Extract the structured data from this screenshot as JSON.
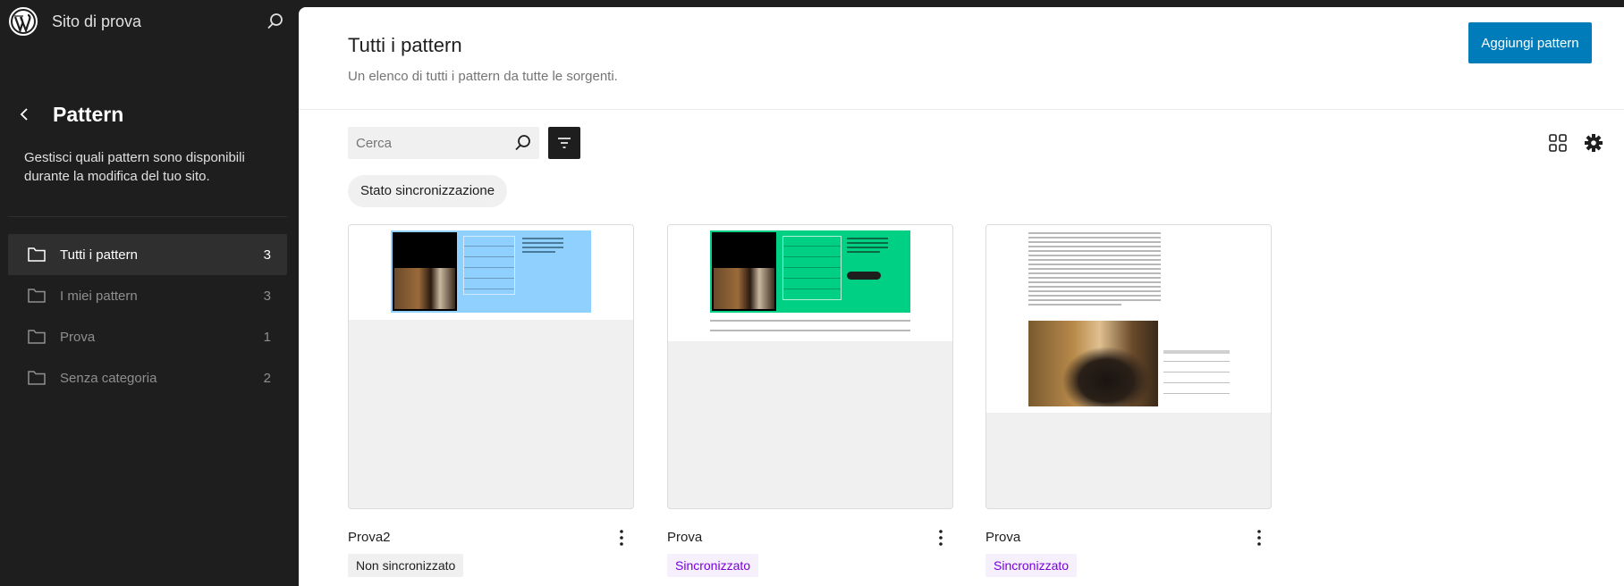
{
  "site": {
    "title": "Sito di prova"
  },
  "nav": {
    "title": "Pattern",
    "description": "Gestisci quali pattern sono disponibili durante la modifica del tuo sito.",
    "items": [
      {
        "label": "Tutti i pattern",
        "count": "3",
        "active": true
      },
      {
        "label": "I miei pattern",
        "count": "3"
      },
      {
        "label": "Prova",
        "count": "1"
      },
      {
        "label": "Senza categoria",
        "count": "2"
      }
    ]
  },
  "header": {
    "title": "Tutti i pattern",
    "subtitle": "Un elenco di tutti i pattern da tutte le sorgenti.",
    "add_button": "Aggiungi pattern"
  },
  "toolbar": {
    "search_placeholder": "Cerca",
    "filter_chip": "Stato sincronizzazione"
  },
  "cards": [
    {
      "title": "Prova2",
      "badge": "Non sincronizzato",
      "synced": false,
      "preview_bg": "#8fd0ff"
    },
    {
      "title": "Prova",
      "badge": "Sincronizzato",
      "synced": true,
      "preview_bg": "#00d084"
    },
    {
      "title": "Prova",
      "badge": "Sincronizzato",
      "synced": true,
      "preview_bg": "#ffffff"
    }
  ],
  "colors": {
    "accent": "#007cba",
    "synced": "#7a00df",
    "sidebar_bg": "#1e1e1e"
  }
}
